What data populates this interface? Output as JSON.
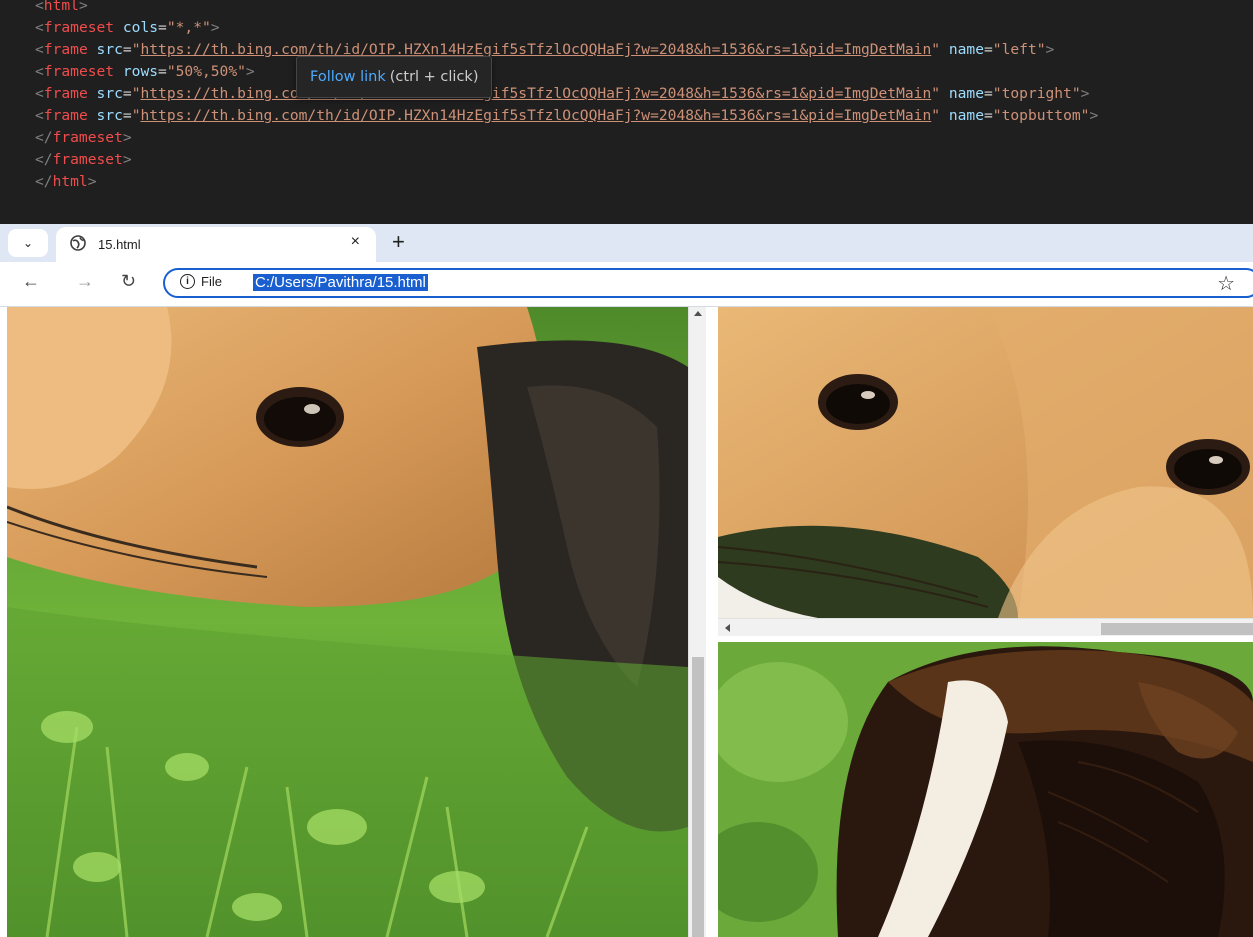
{
  "editor": {
    "lines": [
      [
        {
          "t": "<",
          "c": "punc"
        },
        {
          "t": "html",
          "c": "tag"
        },
        {
          "t": ">",
          "c": "punc"
        }
      ],
      [
        {
          "t": "<",
          "c": "punc"
        },
        {
          "t": "frameset",
          "c": "tag"
        },
        {
          "t": " ",
          "c": "eq"
        },
        {
          "t": "cols",
          "c": "attr"
        },
        {
          "t": "=",
          "c": "eq"
        },
        {
          "t": "\"*,*\"",
          "c": "str"
        },
        {
          "t": ">",
          "c": "punc"
        }
      ],
      [
        {
          "t": "<",
          "c": "punc"
        },
        {
          "t": "frame",
          "c": "tag"
        },
        {
          "t": " ",
          "c": "eq"
        },
        {
          "t": "src",
          "c": "attr"
        },
        {
          "t": "=",
          "c": "eq"
        },
        {
          "t": "\"",
          "c": "str"
        },
        {
          "t": "https://th.bing.com/th/id/OIP.HZXn14HzEgif5sTfzlOcQQHaFj?w=2048&h=1536&rs=1&pid=ImgDetMain",
          "c": "link"
        },
        {
          "t": "\"",
          "c": "str"
        },
        {
          "t": " ",
          "c": "eq"
        },
        {
          "t": "name",
          "c": "attr"
        },
        {
          "t": "=",
          "c": "eq"
        },
        {
          "t": "\"left\"",
          "c": "str"
        },
        {
          "t": ">",
          "c": "punc"
        }
      ],
      [
        {
          "t": "<",
          "c": "punc"
        },
        {
          "t": "frameset",
          "c": "tag"
        },
        {
          "t": " ",
          "c": "eq"
        },
        {
          "t": "rows",
          "c": "attr"
        },
        {
          "t": "=",
          "c": "eq"
        },
        {
          "t": "\"50%,50%\"",
          "c": "str"
        },
        {
          "t": ">",
          "c": "punc"
        }
      ],
      [
        {
          "t": "<",
          "c": "punc"
        },
        {
          "t": "frame",
          "c": "tag"
        },
        {
          "t": " ",
          "c": "eq"
        },
        {
          "t": "src",
          "c": "attr"
        },
        {
          "t": "=",
          "c": "eq"
        },
        {
          "t": "\"",
          "c": "str"
        },
        {
          "t": "https://th.bing.com/th/id/OIP.HZXn14HzEgif5sTfzlOcQQHaFj?w=2048&h=1536&rs=1&pid=ImgDetMain",
          "c": "link"
        },
        {
          "t": "\"",
          "c": "str"
        },
        {
          "t": " ",
          "c": "eq"
        },
        {
          "t": "name",
          "c": "attr"
        },
        {
          "t": "=",
          "c": "eq"
        },
        {
          "t": "\"topright\"",
          "c": "str"
        },
        {
          "t": ">",
          "c": "punc"
        }
      ],
      [
        {
          "t": "<",
          "c": "punc"
        },
        {
          "t": "frame",
          "c": "tag"
        },
        {
          "t": " ",
          "c": "eq"
        },
        {
          "t": "src",
          "c": "attr"
        },
        {
          "t": "=",
          "c": "eq"
        },
        {
          "t": "\"",
          "c": "str"
        },
        {
          "t": "https://th.bing.com/th/id/OIP.HZXn14HzEgif5sTfzlOcQQHaFj?w=2048&h=1536&rs=1&pid=ImgDetMain",
          "c": "link"
        },
        {
          "t": "\"",
          "c": "str"
        },
        {
          "t": " ",
          "c": "eq"
        },
        {
          "t": "name",
          "c": "attr"
        },
        {
          "t": "=",
          "c": "eq"
        },
        {
          "t": "\"topbuttom\"",
          "c": "str"
        },
        {
          "t": ">",
          "c": "punc"
        }
      ],
      [
        {
          "t": "</",
          "c": "punc"
        },
        {
          "t": "frameset",
          "c": "tag"
        },
        {
          "t": ">",
          "c": "punc"
        }
      ],
      [
        {
          "t": "</",
          "c": "punc"
        },
        {
          "t": "frameset",
          "c": "tag"
        },
        {
          "t": ">",
          "c": "punc"
        }
      ],
      [
        {
          "t": "</",
          "c": "punc"
        },
        {
          "t": "html",
          "c": "tag"
        },
        {
          "t": ">",
          "c": "punc"
        }
      ]
    ],
    "tooltip": {
      "link_text": "Follow link",
      "hint": "(ctrl + click)"
    }
  },
  "browser": {
    "tab": {
      "title": "15.html",
      "close_glyph": "×",
      "new_tab_glyph": "+",
      "menu_glyph": "⌄"
    },
    "toolbar": {
      "back_glyph": "←",
      "forward_glyph": "→",
      "reload_glyph": "↻",
      "scheme_label": "File",
      "url": "C:/Users/Pavithra/15.html",
      "bookmark_glyph": "☆"
    }
  },
  "icons": {
    "tab_favicon": "globe-icon",
    "info": "info-icon",
    "bookmark": "star-icon"
  },
  "colors": {
    "editor_bg": "#1f1f1f",
    "tag": "#f14c4c",
    "attr": "#9cdcfe",
    "string": "#ce9178",
    "link_tooltip": "#4daafc",
    "tabstrip": "#dfe7f5",
    "focus": "#1a5fd0"
  }
}
